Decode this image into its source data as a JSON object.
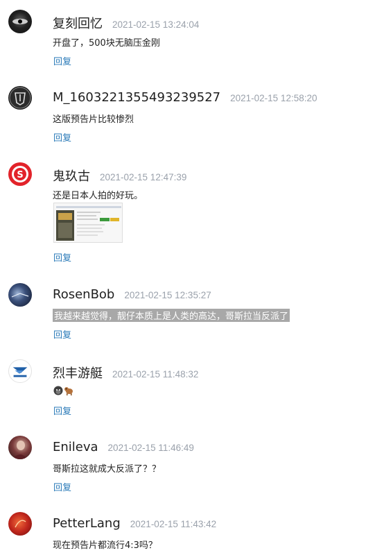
{
  "comments": [
    {
      "username": "复刻回忆",
      "time": "2021-02-15 13:24:04",
      "content": "开盘了，500块无脑压金刚",
      "reply": "回复",
      "avatar_icon": "dark-eye-avatar-icon"
    },
    {
      "username": "M_1603221355493239527",
      "time": "2021-02-15 12:58:20",
      "content": "这版预告片比较惨烈",
      "reply": "回复",
      "avatar_icon": "justice-league-avatar-icon"
    },
    {
      "username": "鬼玖古",
      "time": "2021-02-15 12:47:39",
      "content": "还是日本人拍的好玩。",
      "reply": "回复",
      "avatar_icon": "red-s-avatar-icon",
      "has_image": true
    },
    {
      "username": "RosenBob",
      "time": "2021-02-15 12:35:27",
      "content": "我越来越觉得，靓仔本质上是人类的高达，哥斯拉当反派了",
      "reply": "回复",
      "avatar_icon": "storm-avatar-icon"
    },
    {
      "username": "烈丰游艇",
      "time": "2021-02-15 11:48:32",
      "content": "",
      "reply": "回复",
      "avatar_icon": "bird-logo-avatar-icon",
      "emoji": [
        "gorilla-emoji-icon",
        "dog-emoji-icon"
      ]
    },
    {
      "username": "Enileva",
      "time": "2021-02-15 11:46:49",
      "content": "哥斯拉这就成大反派了？？",
      "reply": "回复",
      "avatar_icon": "portrait-avatar-icon"
    },
    {
      "username": "PetterLang",
      "time": "2021-02-15 11:43:42",
      "content": "现在预告片都流行4:3吗？",
      "reply": "回复",
      "avatar_icon": "red-orb-avatar-icon"
    }
  ],
  "colors": {
    "reply": "#2a7ab8",
    "time": "#9aa1ab",
    "highlight_bg": "#a8a8a8"
  }
}
